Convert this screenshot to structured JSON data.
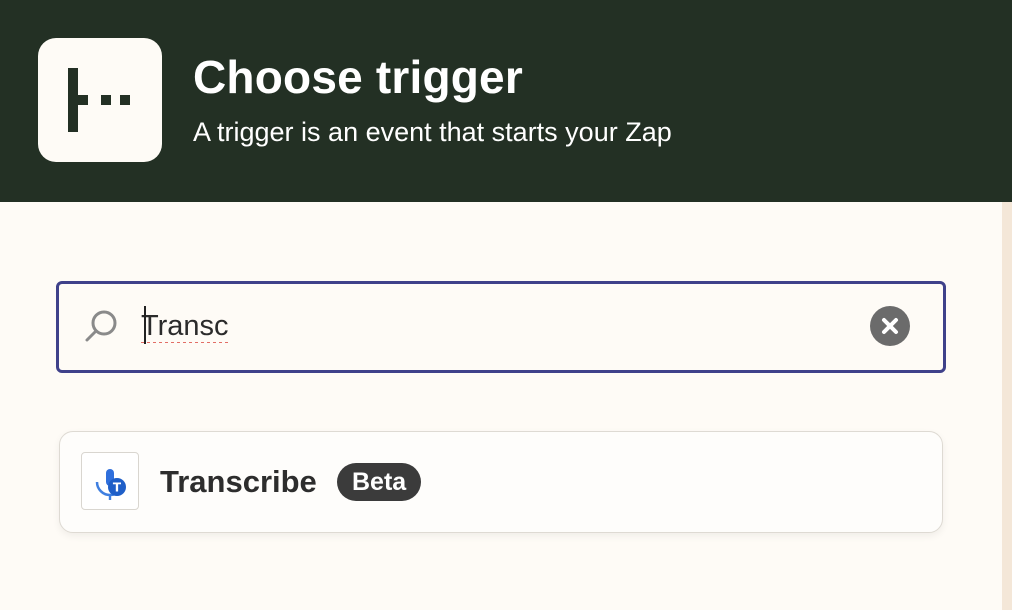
{
  "header": {
    "title": "Choose trigger",
    "subtitle": "A trigger is an event that starts your Zap",
    "logo_icon": "trigger-step-icon",
    "background_color": "#233024"
  },
  "search": {
    "value": "Transc",
    "icon": "search-icon",
    "clear_icon": "clear-icon",
    "border_color": "#3f418a"
  },
  "results": [
    {
      "label": "Transcribe",
      "badge": "Beta",
      "icon": "transcribe-icon"
    }
  ]
}
